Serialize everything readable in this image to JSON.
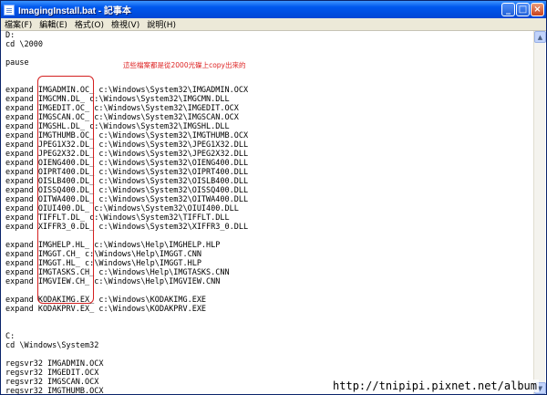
{
  "window": {
    "title": "ImagingInstall.bat - 記事本",
    "controls": {
      "minimize": "_",
      "maximize": "□",
      "close": "×"
    }
  },
  "menu": [
    "檔案(F)",
    "編輯(E)",
    "格式(O)",
    "檢視(V)",
    "說明(H)"
  ],
  "editor": {
    "lines": [
      "D:",
      "cd \\2000",
      "",
      "pause",
      "",
      "",
      "expand IMGADMIN.OC_ c:\\Windows\\System32\\IMGADMIN.OCX",
      "expand IMGCMN.DL_ c:\\Windows\\System32\\IMGCMN.DLL",
      "expand IMGEDIT.OC_ c:\\Windows\\System32\\IMGEDIT.OCX",
      "expand IMGSCAN.OC_ c:\\Windows\\System32\\IMGSCAN.OCX",
      "expand IMGSHL.DL_ c:\\Windows\\System32\\IMGSHL.DLL",
      "expand IMGTHUMB.OC_ c:\\Windows\\System32\\IMGTHUMB.OCX",
      "expand JPEG1X32.DL_ c:\\Windows\\System32\\JPEG1X32.DLL",
      "expand JPEG2X32.DL_ c:\\Windows\\System32\\JPEG2X32.DLL",
      "expand OIENG400.DL_ c:\\Windows\\System32\\OIENG400.DLL",
      "expand OIPRT400.DL_ c:\\Windows\\System32\\OIPRT400.DLL",
      "expand OISLB400.DL_ c:\\Windows\\System32\\OISLB400.DLL",
      "expand OISSQ400.DL_ c:\\Windows\\System32\\OISSQ400.DLL",
      "expand OITWA400.DL_ c:\\Windows\\System32\\OITWA400.DLL",
      "expand OIUI400.DL_ c:\\Windows\\System32\\OIUI400.DLL",
      "expand TIFFLT.DL_ c:\\Windows\\System32\\TIFFLT.DLL",
      "expand XIFFR3_0.DL_ c:\\Windows\\System32\\XIFFR3_0.DLL",
      "",
      "expand IMGHELP.HL_ c:\\Windows\\Help\\IMGHELP.HLP",
      "expand IMGGT.CH_ c:\\Windows\\Help\\IMGGT.CNN",
      "expand IMGGT.HL_ c:\\Windows\\Help\\IMGGT.HLP",
      "expand IMGTASKS.CH_ c:\\Windows\\Help\\IMGTASKS.CNN",
      "expand IMGVIEW.CH_ c:\\Windows\\Help\\IMGVIEW.CNN",
      "",
      "expand KODAKIMG.EX_ c:\\Windows\\KODAKIMG.EXE",
      "expand KODAKPRV.EX_ c:\\Windows\\KODAKPRV.EXE",
      "",
      "",
      "C:",
      "cd \\Windows\\System32",
      "",
      "regsvr32 IMGADMIN.OCX",
      "regsvr32 IMGEDIT.OCX",
      "regsvr32 IMGSCAN.OCX",
      "regsvr32 IMGTHUMB.OCX"
    ]
  },
  "annotation": "這些檔案都是從2000光碟上copy出來的",
  "watermark": "http://tnipipi.pixnet.net/album",
  "colors": {
    "titlebar": "#0054e3",
    "menubar": "#ece9d8",
    "annotation_red": "#d42020"
  },
  "icons": {
    "app": "notepad-icon"
  }
}
